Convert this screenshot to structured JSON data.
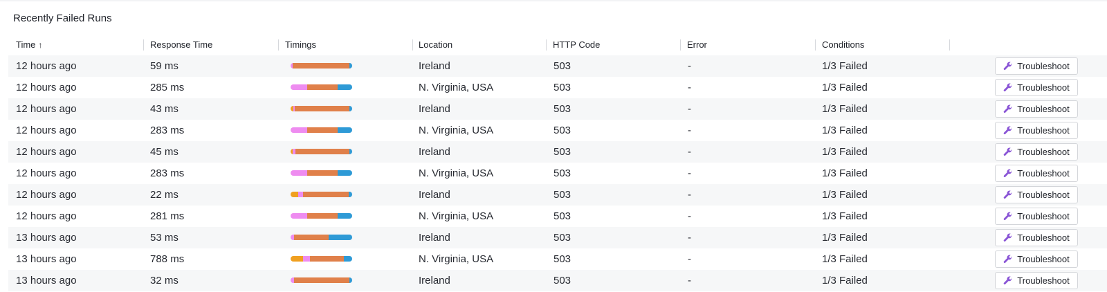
{
  "title": "Recently Failed Runs",
  "columns": [
    {
      "label": "Time",
      "sort": "↑"
    },
    {
      "label": "Response Time"
    },
    {
      "label": "Timings"
    },
    {
      "label": "Location"
    },
    {
      "label": "HTTP Code"
    },
    {
      "label": "Error"
    },
    {
      "label": "Conditions"
    }
  ],
  "action_label": "Troubleshoot",
  "timing_colors": {
    "orange": "#f0a020",
    "pink": "#ee8cf0",
    "red": "#e0804a",
    "blue": "#2e9ad6"
  },
  "rows": [
    {
      "time": "12 hours ago",
      "response": "59 ms",
      "location": "Ireland",
      "http": "503",
      "error": "-",
      "conditions": "1/3 Failed",
      "timing": [
        [
          "pink",
          3
        ],
        [
          "red",
          92
        ],
        [
          "blue",
          5
        ]
      ]
    },
    {
      "time": "12 hours ago",
      "response": "285 ms",
      "location": "N. Virginia, USA",
      "http": "503",
      "error": "-",
      "conditions": "1/3 Failed",
      "timing": [
        [
          "pink",
          27
        ],
        [
          "red",
          49
        ],
        [
          "blue",
          24
        ]
      ]
    },
    {
      "time": "12 hours ago",
      "response": "43 ms",
      "location": "Ireland",
      "http": "503",
      "error": "-",
      "conditions": "1/3 Failed",
      "timing": [
        [
          "orange",
          4
        ],
        [
          "pink",
          3
        ],
        [
          "red",
          89
        ],
        [
          "blue",
          4
        ]
      ]
    },
    {
      "time": "12 hours ago",
      "response": "283 ms",
      "location": "N. Virginia, USA",
      "http": "503",
      "error": "-",
      "conditions": "1/3 Failed",
      "timing": [
        [
          "pink",
          27
        ],
        [
          "red",
          49
        ],
        [
          "blue",
          24
        ]
      ]
    },
    {
      "time": "12 hours ago",
      "response": "45 ms",
      "location": "Ireland",
      "http": "503",
      "error": "-",
      "conditions": "1/3 Failed",
      "timing": [
        [
          "orange",
          3
        ],
        [
          "pink",
          5
        ],
        [
          "red",
          88
        ],
        [
          "blue",
          4
        ]
      ]
    },
    {
      "time": "12 hours ago",
      "response": "283 ms",
      "location": "N. Virginia, USA",
      "http": "503",
      "error": "-",
      "conditions": "1/3 Failed",
      "timing": [
        [
          "pink",
          27
        ],
        [
          "red",
          49
        ],
        [
          "blue",
          24
        ]
      ]
    },
    {
      "time": "12 hours ago",
      "response": "22 ms",
      "location": "Ireland",
      "http": "503",
      "error": "-",
      "conditions": "1/3 Failed",
      "timing": [
        [
          "orange",
          12
        ],
        [
          "pink",
          8
        ],
        [
          "red",
          74
        ],
        [
          "blue",
          6
        ]
      ]
    },
    {
      "time": "12 hours ago",
      "response": "281 ms",
      "location": "N. Virginia, USA",
      "http": "503",
      "error": "-",
      "conditions": "1/3 Failed",
      "timing": [
        [
          "pink",
          27
        ],
        [
          "red",
          49
        ],
        [
          "blue",
          24
        ]
      ]
    },
    {
      "time": "13 hours ago",
      "response": "53 ms",
      "location": "Ireland",
      "http": "503",
      "error": "-",
      "conditions": "1/3 Failed",
      "timing": [
        [
          "pink",
          6
        ],
        [
          "red",
          56
        ],
        [
          "blue",
          38
        ]
      ]
    },
    {
      "time": "13 hours ago",
      "response": "788 ms",
      "location": "N. Virginia, USA",
      "http": "503",
      "error": "-",
      "conditions": "1/3 Failed",
      "timing": [
        [
          "orange",
          20
        ],
        [
          "pink",
          12
        ],
        [
          "red",
          55
        ],
        [
          "blue",
          13
        ]
      ]
    },
    {
      "time": "13 hours ago",
      "response": "32 ms",
      "location": "Ireland",
      "http": "503",
      "error": "-",
      "conditions": "1/3 Failed",
      "timing": [
        [
          "pink",
          6
        ],
        [
          "red",
          89
        ],
        [
          "blue",
          5
        ]
      ]
    }
  ]
}
